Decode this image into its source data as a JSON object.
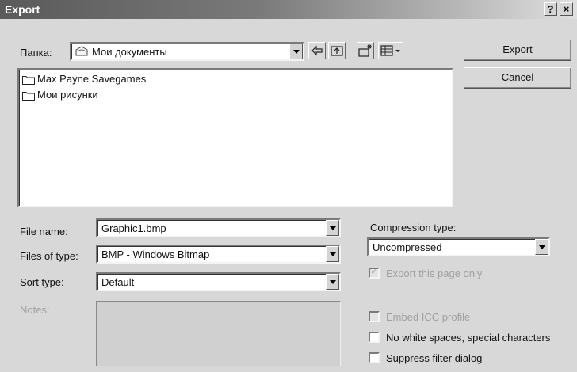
{
  "window": {
    "title": "Export",
    "help_label": "?",
    "close_label": "×"
  },
  "folder_bar": {
    "label": "Папка:",
    "current_folder": "Мои документы"
  },
  "files": [
    {
      "name": "Max Payne Savegames"
    },
    {
      "name": "Мои рисунки"
    }
  ],
  "buttons": {
    "export": "Export",
    "cancel": "Cancel"
  },
  "file_name": {
    "label": "File name:",
    "value": "Graphic1.bmp"
  },
  "files_of_type": {
    "label": "Files of type:",
    "value": "BMP - Windows Bitmap"
  },
  "sort_type": {
    "label": "Sort type:",
    "value": "Default"
  },
  "notes": {
    "label": "Notes:"
  },
  "compression": {
    "label": "Compression type:",
    "value": "Uncompressed"
  },
  "options": {
    "export_page_only": {
      "label": "Export this page only",
      "checked": true,
      "enabled": false
    },
    "embed_icc": {
      "label": "Embed ICC profile",
      "checked": false,
      "enabled": false
    },
    "no_white_spaces": {
      "label": "No white spaces, special characters",
      "checked": false,
      "enabled": true
    },
    "suppress_filter": {
      "label": "Suppress filter dialog",
      "checked": false,
      "enabled": true
    }
  },
  "colors": {
    "dialog_bg": "#d8d8d8",
    "title_dark": "#5a5a5a",
    "disabled_text": "#a0a0a0"
  },
  "icons": [
    "back-icon",
    "up-folder-icon",
    "new-folder-icon",
    "view-menu-icon",
    "folder-icon"
  ]
}
